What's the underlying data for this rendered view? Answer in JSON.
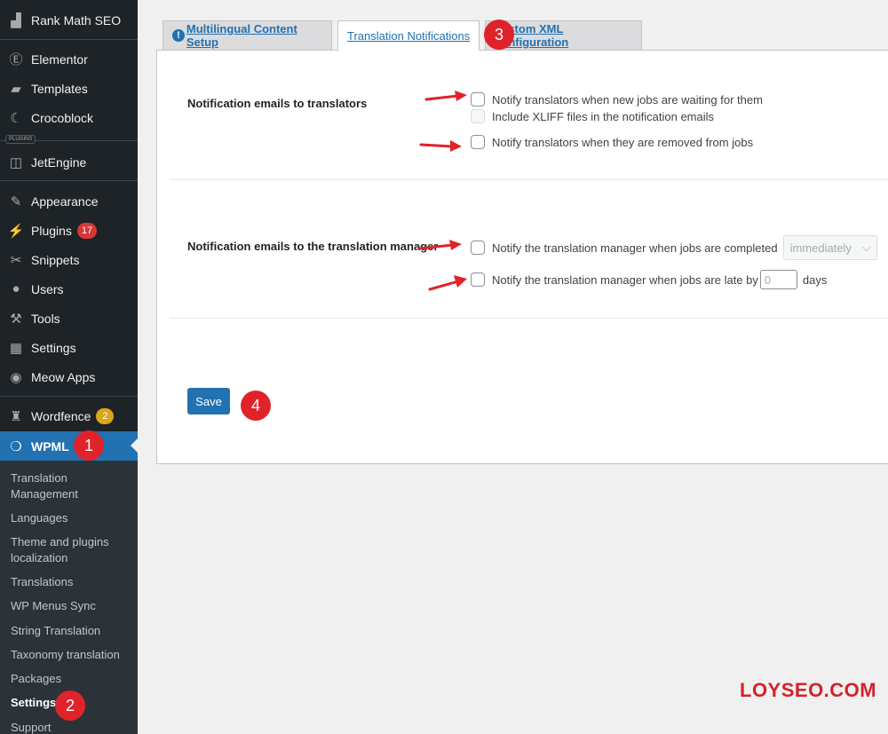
{
  "sidebar": {
    "items": [
      {
        "key": "rankmath",
        "label": "Rank Math SEO",
        "icon": "rank-math-icon",
        "glyph": "▟"
      },
      {
        "key": "elementor",
        "label": "Elementor",
        "icon": "elementor-icon",
        "glyph": "Ⓔ"
      },
      {
        "key": "templates",
        "label": "Templates",
        "icon": "folder-icon",
        "glyph": "▰"
      },
      {
        "key": "crocoblock",
        "label": "Crocoblock",
        "icon": "crocoblock-icon",
        "glyph": "☾"
      },
      {
        "key": "jetengine",
        "label": "JetEngine",
        "icon": "jetengine-icon",
        "glyph": "◫"
      },
      {
        "key": "appearance",
        "label": "Appearance",
        "icon": "paintbrush-icon",
        "glyph": "✎"
      },
      {
        "key": "plugins",
        "label": "Plugins",
        "icon": "plug-icon",
        "glyph": "⚡",
        "badge": "17"
      },
      {
        "key": "snippets",
        "label": "Snippets",
        "icon": "scissors-icon",
        "glyph": "✂"
      },
      {
        "key": "users",
        "label": "Users",
        "icon": "user-icon",
        "glyph": "●"
      },
      {
        "key": "tools",
        "label": "Tools",
        "icon": "wrench-icon",
        "glyph": "⚒"
      },
      {
        "key": "settings",
        "label": "Settings",
        "icon": "sliders-icon",
        "glyph": "▦"
      },
      {
        "key": "meow",
        "label": "Meow Apps",
        "icon": "meow-apps-icon",
        "glyph": "◉"
      },
      {
        "key": "wordfence",
        "label": "Wordfence",
        "icon": "wordfence-icon",
        "glyph": "♜",
        "badge": "2"
      },
      {
        "key": "wpml",
        "label": "WPML",
        "icon": "wpml-icon",
        "glyph": "❍"
      }
    ],
    "plugins_tag": "PLUGINS",
    "submenu": [
      "Translation Management",
      "Languages",
      "Theme and plugins localization",
      "Translations",
      "WP Menus Sync",
      "String Translation",
      "Taxonomy translation",
      "Packages",
      "Settings",
      "Support"
    ]
  },
  "tabs": {
    "multilingual": "Multilingual Content Setup",
    "notifications": "Translation Notifications",
    "xml": "Custom XML Configuration",
    "info_glyph": "!"
  },
  "translators": {
    "label": "Notification emails to translators",
    "opt_waiting": "Notify translators when new jobs are waiting for them",
    "opt_xliff": "Include XLIFF files in the notification emails",
    "opt_removed": "Notify translators when they are removed from jobs"
  },
  "manager": {
    "label": "Notification emails to the translation manager",
    "opt_completed": "Notify the translation manager when jobs are completed",
    "completed_select": "immediately",
    "opt_late": "Notify the translation manager when jobs are late by",
    "late_days_value": "0",
    "days_label": "days"
  },
  "save_label": "Save",
  "annotations": {
    "step1": "1",
    "step2": "2",
    "step3": "3",
    "step4": "4",
    "watermark": "LOYSEO.COM",
    "color": "#e0232b"
  },
  "colors": {
    "sidebar": "#1d2327",
    "submenu": "#2c3338",
    "accent": "#2271b1",
    "badge": "#d63638"
  }
}
